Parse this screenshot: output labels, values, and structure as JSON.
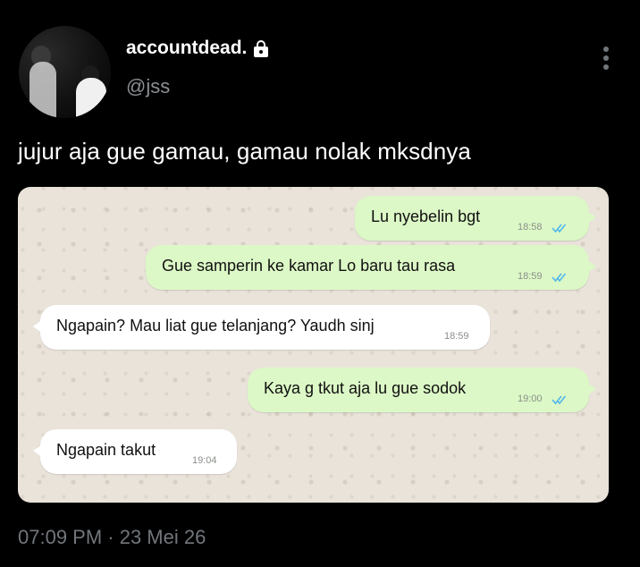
{
  "profile": {
    "display_name": "accountdead.",
    "handle": "@jss",
    "avatar_icon": "profile-photo",
    "locked_icon": "lock-icon"
  },
  "tweet": {
    "text": "jujur aja gue gamau, gamau nolak mksdnya",
    "timestamp": "07:09 PM · 23 Mei 26"
  },
  "chat": {
    "messages": [
      {
        "direction": "outgoing",
        "text": "Lu nyebelin bgt",
        "time": "18:58",
        "status": "read"
      },
      {
        "direction": "outgoing",
        "text": "Gue samperin ke kamar Lo baru tau rasa",
        "time": "18:59",
        "status": "read"
      },
      {
        "direction": "incoming",
        "text": "Ngapain? Mau liat gue telanjang? Yaudh sinj",
        "time": "18:59"
      },
      {
        "direction": "outgoing",
        "text": "Kaya g tkut aja lu gue sodok",
        "time": "19:00",
        "status": "read"
      },
      {
        "direction": "incoming",
        "text": "Ngapain takut",
        "time": "19:04"
      }
    ]
  },
  "colors": {
    "background": "#000000",
    "chat_wallpaper": "#e9e3da",
    "outgoing_bubble": "#dcf8c6",
    "incoming_bubble": "#ffffff",
    "read_ticks": "#4fb6ec",
    "secondary_text": "#71767b"
  }
}
